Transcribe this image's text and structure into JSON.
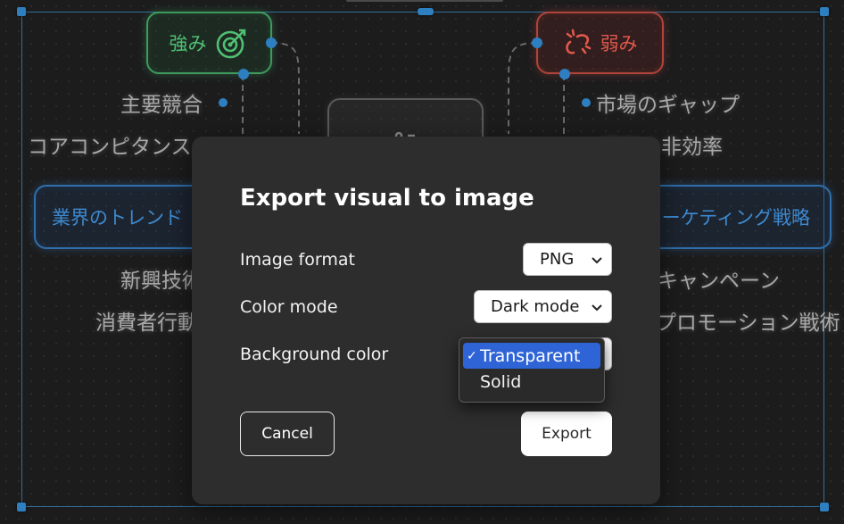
{
  "mindmap": {
    "nodes": {
      "strengths": "強み",
      "weaknesses": "弱み",
      "industry_trends": "業界のトレンド",
      "marketing_strategy": "マーケティング戦略"
    },
    "labels": {
      "key_competition": "主要競合",
      "core_competence": "コアコンピタンス",
      "market_gap": "市場のギャップ",
      "operational_inefficiency": "運営の非効率",
      "emerging_tech": "新興技術",
      "consumer_behavior": "消費者行動",
      "campaign": "キャンペーン",
      "promotion_tactics": "プロモーション戦術"
    }
  },
  "dialog": {
    "title": "Export visual to image",
    "image_format_label": "Image format",
    "image_format_value": "PNG",
    "color_mode_label": "Color mode",
    "color_mode_value": "Dark mode",
    "background_color_label": "Background color",
    "background_options": [
      "Transparent",
      "Solid"
    ],
    "background_selected": "Transparent",
    "check_mark": "✓",
    "cancel_label": "Cancel",
    "export_label": "Export"
  },
  "colors": {
    "accent": "#2f64d6",
    "strength_green": "#4fc073",
    "weakness_red": "#e0584c",
    "trend_blue": "#3d8ad1"
  }
}
